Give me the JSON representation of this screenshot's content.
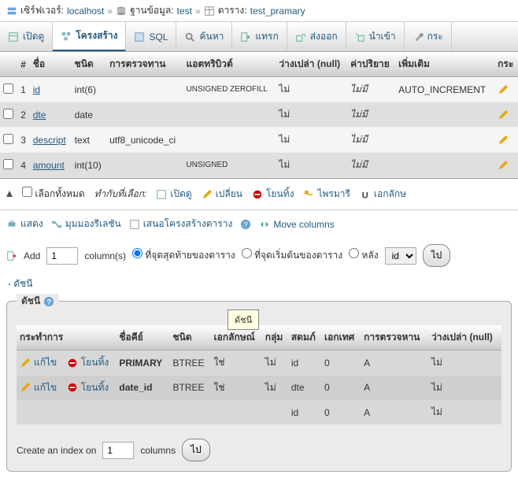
{
  "breadcrumb": {
    "server_label": "เซิร์ฟเวอร์:",
    "server_value": "localhost",
    "db_label": "ฐานข้อมูล:",
    "db_value": "test",
    "table_label": "ตาราง:",
    "table_value": "test_pramary"
  },
  "tabs": {
    "browse": "เปิดดู",
    "structure": "โครงสร้าง",
    "sql": "SQL",
    "search": "ค้นหา",
    "insert": "แทรก",
    "export": "ส่งออก",
    "import": "นำเข้า",
    "operations": "กระ"
  },
  "cols_headers": {
    "num": "#",
    "name": "ชื่อ",
    "type": "ชนิด",
    "collation": "การตรวจทาน",
    "attributes": "แอตทริบิวต์",
    "null": "ว่างเปล่า (null)",
    "default": "ค่าปริยาย",
    "extra": "เพิ่มเติม",
    "action": "กระ"
  },
  "columns": [
    {
      "num": "1",
      "name": "id",
      "type": "int(6)",
      "collation": "",
      "attr": "UNSIGNED ZEROFILL",
      "null": "ไม่",
      "default": "ไม่มี",
      "extra": "AUTO_INCREMENT"
    },
    {
      "num": "2",
      "name": "dte",
      "type": "date",
      "collation": "",
      "attr": "",
      "null": "ไม่",
      "default": "ไม่มี",
      "extra": ""
    },
    {
      "num": "3",
      "name": "descript",
      "type": "text",
      "collation": "utf8_unicode_ci",
      "attr": "",
      "null": "ไม่",
      "default": "ไม่มี",
      "extra": ""
    },
    {
      "num": "4",
      "name": "amount",
      "type": "int(10)",
      "collation": "",
      "attr": "UNSIGNED",
      "null": "ไม่",
      "default": "ไม่มี",
      "extra": ""
    }
  ],
  "actions": {
    "checkall": "เลือกทั้งหมด",
    "withselected": "ทำกับที่เลือก:",
    "browse": "เปิดดู",
    "change": "เปลี่ยน",
    "drop": "โยนทิ้ง",
    "primary": "ไพรมารี",
    "unique": "เอกลักษ"
  },
  "section2": {
    "print": "แสดง",
    "relation": "มุมมองรีเลชัน",
    "propose": "เสนอโครงสร้างตาราง",
    "movecols": "Move columns"
  },
  "addcols": {
    "add": "Add",
    "value": "1",
    "columns": "column(s)",
    "atend": "ที่จุดสุดท้ายของตาราง",
    "atbegin": "ที่จุดเริ่มต้นของตาราง",
    "after": "หลัง",
    "after_col": "id",
    "go": "ไป"
  },
  "dashlabel": "ดัชนี",
  "panel_legend": "ดัชนี",
  "tooltip": "ดัชนี",
  "idx_headers": {
    "action": "กระทำการ",
    "keyname": "ชื่อคีย์",
    "type": "ชนิด",
    "unique": "เอกลักษณ์",
    "packed": "กลุ่ม",
    "column": "สดมภ์",
    "cardinality": "เอกเทศ",
    "collation": "การตรวจหาน",
    "null": "ว่างเปล่า (null)"
  },
  "idx_actions": {
    "edit": "แก้ไข",
    "drop": "โยนทิ้ง"
  },
  "indexes": [
    {
      "keyname": "PRIMARY",
      "type": "BTREE",
      "unique": "ใช่",
      "packed": "ไม่",
      "column": "id",
      "card": "0",
      "coll": "A",
      "null": "ไม่"
    },
    {
      "keyname": "date_id",
      "type": "BTREE",
      "unique": "ใช่",
      "packed": "ไม่",
      "column": "dte",
      "card": "0",
      "coll": "A",
      "null": "ไม่"
    },
    {
      "keyname": "",
      "type": "",
      "unique": "",
      "packed": "",
      "column": "id",
      "card": "0",
      "coll": "A",
      "null": "ไม่"
    }
  ],
  "createidx": {
    "label": "Create an index on",
    "value": "1",
    "columns": "columns",
    "go": "ไป"
  }
}
